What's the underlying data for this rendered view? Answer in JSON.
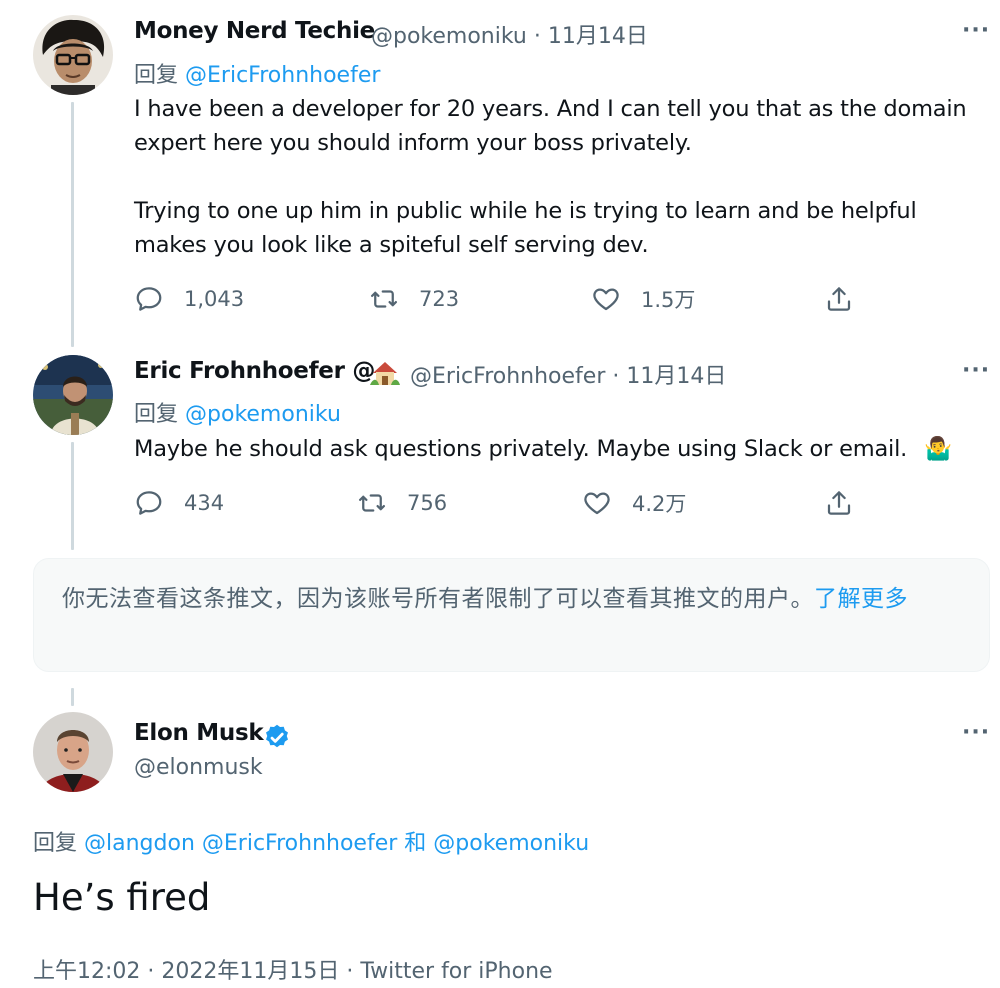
{
  "tweets": [
    {
      "name": "Money Nerd Techie",
      "handle_time": "@pokemoniku · 11月14日",
      "reply_prefix": "回复",
      "reply_to": "@EricFrohnhoefer",
      "text": "I have been a developer for 20 years.  And I can tell you that as the domain\nexpert here you should inform your boss privately.\n\nTrying to one up him in public while he is trying to learn and be helpful\nmakes you look like a spiteful self serving dev.",
      "replies": "1,043",
      "retweets": "723",
      "likes": "1.5万"
    },
    {
      "name": "Eric Frohnhoefer @",
      "handle_time": "@EricFrohnhoefer · 11月14日",
      "reply_prefix": "回复",
      "reply_to": "@pokemoniku",
      "text": "Maybe he should ask questions privately. Maybe using Slack or email.",
      "emoji": "🤷‍♂️",
      "replies": "434",
      "retweets": "756",
      "likes": "4.2万"
    }
  ],
  "notice": {
    "text": "你无法查看这条推文，因为该账号所有者限制了可以查看其推文的用户。",
    "link": "了解更多"
  },
  "main_tweet": {
    "name": "Elon Musk",
    "handle": "@elonmusk",
    "reply_prefix": "回复",
    "reply_to_1": "@langdon",
    "reply_to_2": "@EricFrohnhoefer",
    "and_word": "和",
    "reply_to_3": "@pokemoniku",
    "text": "He’s fired",
    "meta": "上午12:02 · 2022年11月15日 · Twitter for iPhone"
  },
  "more_label": "···",
  "colors": {
    "link": "#1d9bf0",
    "secondary": "#536471",
    "verified": "#1d9bf0"
  }
}
